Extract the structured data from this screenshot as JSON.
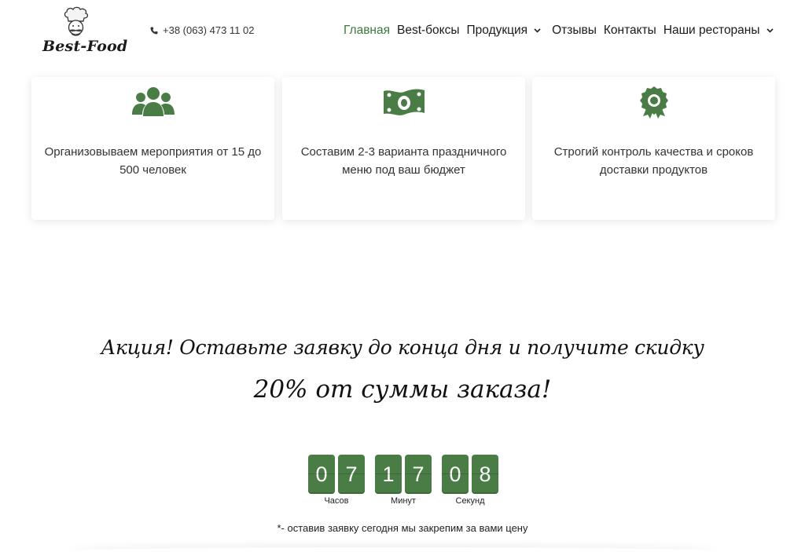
{
  "header": {
    "logo_text": "Best-Food",
    "phone": "+38 (063) 473 11 02",
    "nav": [
      {
        "label": "Главная",
        "active": true,
        "dropdown": false
      },
      {
        "label": "Best-боксы",
        "active": false,
        "dropdown": false
      },
      {
        "label": "Продукция",
        "active": false,
        "dropdown": true
      },
      {
        "label": "Отзывы",
        "active": false,
        "dropdown": false
      },
      {
        "label": "Контакты",
        "active": false,
        "dropdown": false
      },
      {
        "label": "Наши рестораны",
        "active": false,
        "dropdown": true
      }
    ]
  },
  "features": [
    {
      "icon": "users-icon",
      "text": "Организовываем мероприятия от 15 до 500 человек"
    },
    {
      "icon": "money-icon",
      "text": "Составим 2-3 варианта праздничного меню под ваш бюджет"
    },
    {
      "icon": "award-icon",
      "text": "Строгий контроль качества и сроков доставки продуктов"
    }
  ],
  "promo": {
    "line1": "Акция! Оставьте заявку до конца дня и получите скидку",
    "line2": "20% от суммы заказа!"
  },
  "countdown": {
    "hours": [
      "0",
      "7"
    ],
    "minutes": [
      "1",
      "7"
    ],
    "seconds": [
      "0",
      "8"
    ],
    "hours_label": "Часов",
    "minutes_label": "Минут",
    "seconds_label": "Секунд"
  },
  "note": "*- оставив заявку сегодня мы закрепим за вами цену",
  "colors": {
    "accent": "#4a7c45",
    "nav_active": "#3a7a3a"
  }
}
